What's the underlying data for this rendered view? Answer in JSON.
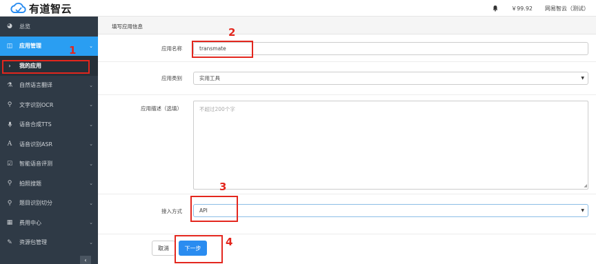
{
  "brand": {
    "name": "有道智云"
  },
  "topbar": {
    "balance": "￥99.92",
    "account": "网易智云（测试）"
  },
  "sidebar": {
    "items": [
      {
        "label": "总览",
        "icon": "dashboard-icon",
        "glyph": "◕"
      },
      {
        "label": "应用管理",
        "icon": "app-manage-icon",
        "glyph": "◫",
        "active": true
      },
      {
        "label": "我的应用",
        "icon": "chevron-right-icon",
        "glyph": "›",
        "sub": true
      },
      {
        "label": "自然语言翻译",
        "icon": "flask-icon",
        "glyph": "⚗"
      },
      {
        "label": "文字识别OCR",
        "icon": "search-icon",
        "glyph": "⚲"
      },
      {
        "label": "语音合成TTS",
        "icon": "microphone-icon",
        "glyph": "🎙"
      },
      {
        "label": "语音识别ASR",
        "icon": "font-icon",
        "glyph": "A"
      },
      {
        "label": "智能语音评测",
        "icon": "check-square-icon",
        "glyph": "☑"
      },
      {
        "label": "拍照搜题",
        "icon": "search-icon",
        "glyph": "⚲"
      },
      {
        "label": "题目识别切分",
        "icon": "search-icon",
        "glyph": "⚲"
      },
      {
        "label": "费用中心",
        "icon": "bar-chart-icon",
        "glyph": "▦"
      },
      {
        "label": "资源包管理",
        "icon": "edit-icon",
        "glyph": "✎"
      }
    ],
    "collapse_glyph": "‹"
  },
  "form": {
    "section_title": "填写应用信息",
    "name_label": "应用名称",
    "name_value": "transmate",
    "type_label": "应用类别",
    "type_value": "实用工具",
    "desc_label": "应用描述（选填）",
    "desc_placeholder": "不超过200个字",
    "access_label": "接入方式",
    "access_value": "API",
    "cancel_label": "取消",
    "next_label": "下一步"
  },
  "annotations": [
    "1",
    "2",
    "3",
    "4"
  ],
  "colors": {
    "accent": "#2a9ef2",
    "sidebar": "#2f3a46",
    "annotation": "#e3261d"
  }
}
